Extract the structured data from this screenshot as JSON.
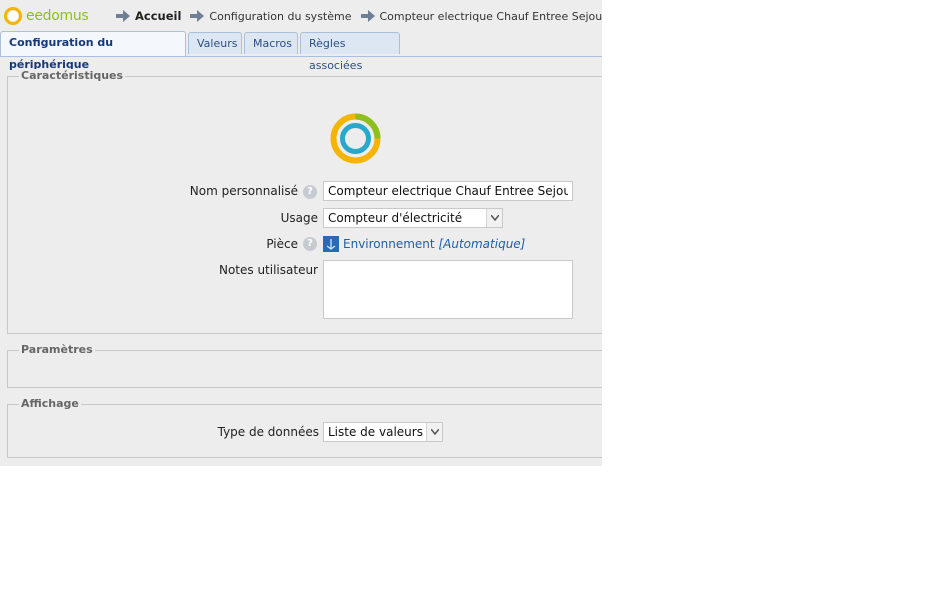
{
  "header": {
    "logo_text": "eedomus",
    "breadcrumbs": [
      "Accueil",
      "Configuration du système",
      "Compteur electrique Chauf Entree Sejour (configurat"
    ]
  },
  "tabs": [
    {
      "label": "Configuration du périphérique",
      "active": true
    },
    {
      "label": "Valeurs",
      "active": false
    },
    {
      "label": "Macros",
      "active": false
    },
    {
      "label": "Règles associées",
      "active": false
    }
  ],
  "caracteristiques": {
    "legend": "Caractéristiques",
    "nom_label": "Nom personnalisé",
    "nom_value": "Compteur electrique Chauf Entree Sejour",
    "usage_label": "Usage",
    "usage_value": "Compteur d'électricité",
    "piece_label": "Pièce",
    "piece_value": "Environnement",
    "piece_auto": "[Automatique]",
    "notes_label": "Notes utilisateur",
    "help_glyph": "?"
  },
  "parametres": {
    "legend": "Paramètres"
  },
  "affichage": {
    "legend": "Affichage",
    "type_label": "Type de données",
    "type_value": "Liste de valeurs"
  },
  "colors": {
    "accent": "#2b4f81",
    "logo_green": "#8dbf1f",
    "logo_yellow": "#f4b400",
    "logo_blue": "#2aa8c9",
    "link": "#1f5fa8"
  }
}
